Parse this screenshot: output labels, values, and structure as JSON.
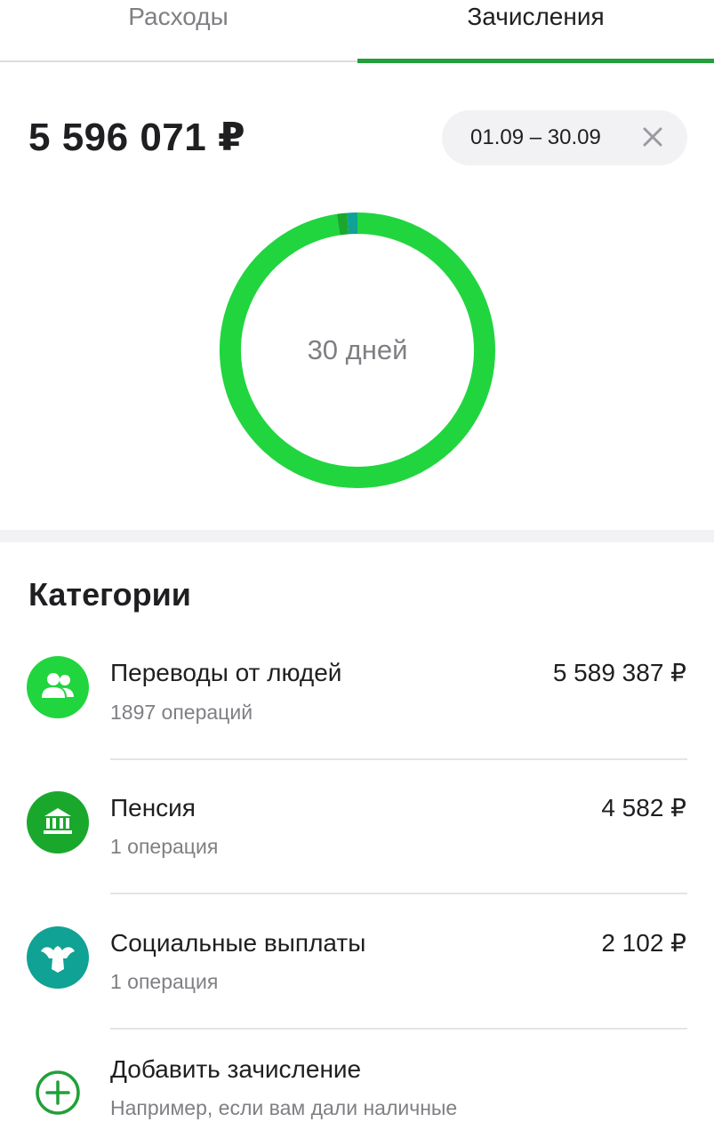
{
  "tabs": {
    "expenses_label": "Расходы",
    "income_label": "Зачисления"
  },
  "summary": {
    "total": "5 596 071 ₽",
    "date_range": "01.09 – 30.09"
  },
  "chart_data": {
    "type": "pie",
    "center_label": "30 дней",
    "categories": [
      "Переводы от людей",
      "Пенсия",
      "Социальные выплаты"
    ],
    "values": [
      5589387,
      4582,
      2102
    ],
    "colors": [
      "#21d53f",
      "#1aa82c",
      "#10a294"
    ]
  },
  "categories": {
    "title": "Категории",
    "items": [
      {
        "name": "Переводы от людей",
        "count": "1897 операций",
        "amount": "5 589 387 ₽",
        "icon": "people-icon",
        "color": "#21d53f"
      },
      {
        "name": "Пенсия",
        "count": "1 операция",
        "amount": "4 582 ₽",
        "icon": "bank-icon",
        "color": "#1aa82c"
      },
      {
        "name": "Социальные выплаты",
        "count": "1 операция",
        "amount": "2 102 ₽",
        "icon": "eagle-icon",
        "color": "#10a294"
      }
    ]
  },
  "add_income": {
    "title": "Добавить зачисление",
    "subtitle": "Например, если вам дали наличные",
    "accent": "#21a038"
  }
}
